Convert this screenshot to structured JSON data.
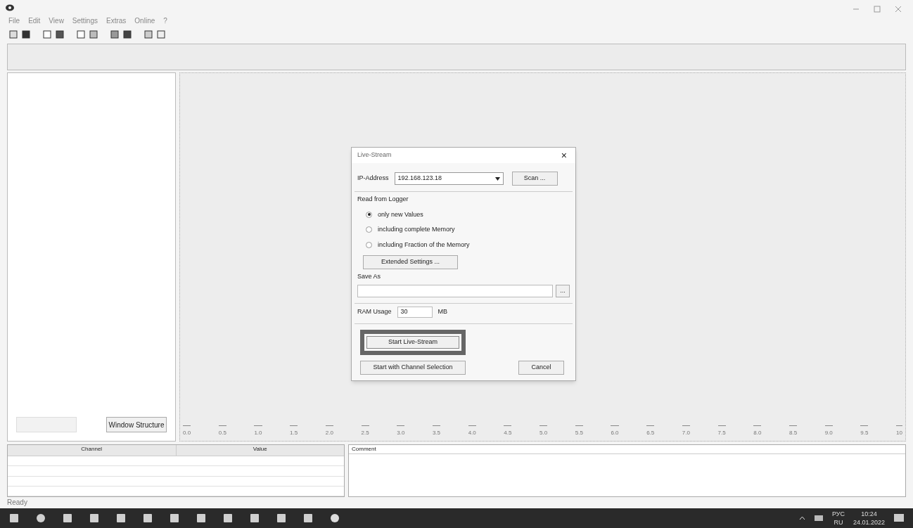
{
  "menu": [
    "File",
    "Edit",
    "View",
    "Settings",
    "Extras",
    "Online",
    "?"
  ],
  "left_panel": {
    "buttons": [
      {
        "disabled": true
      },
      {
        "label": "Window Structure",
        "disabled": false
      }
    ]
  },
  "axis": {
    "ticks": [
      "0.0",
      "0.5",
      "1.0",
      "1.5",
      "2.0",
      "2.5",
      "3.0",
      "3.5",
      "4.0",
      "4.5",
      "5.0",
      "5.5",
      "6.0",
      "6.5",
      "7.0",
      "7.5",
      "8.0",
      "8.5",
      "9.0",
      "9.5",
      "10"
    ]
  },
  "table": {
    "columns": [
      "Channel",
      "Value"
    ]
  },
  "comment": {
    "label": "Comment"
  },
  "status_bar": "Ready",
  "dialog": {
    "title": "Live-Stream",
    "close": "×",
    "ip_label": "IP-Address",
    "ip_value": "192.168.123.18",
    "scan": "Scan ...",
    "group": "Read from Logger",
    "options": [
      {
        "label": "only new Values",
        "selected": true
      },
      {
        "label": "including complete Memory",
        "selected": false
      },
      {
        "label": "including Fraction of the Memory",
        "selected": false
      }
    ],
    "extended": "Extended Settings ...",
    "save_as": "Save As",
    "browse": "...",
    "ram_label": "RAM Usage",
    "ram_value": "30",
    "ram_unit": "MB",
    "start": "Start Live-Stream",
    "start_channel": "Start with Channel Selection",
    "cancel": "Cancel"
  },
  "tray": {
    "lang_top": "РУС",
    "lang_bottom": "RU",
    "time": "10:24",
    "date": "24.01.2022"
  }
}
